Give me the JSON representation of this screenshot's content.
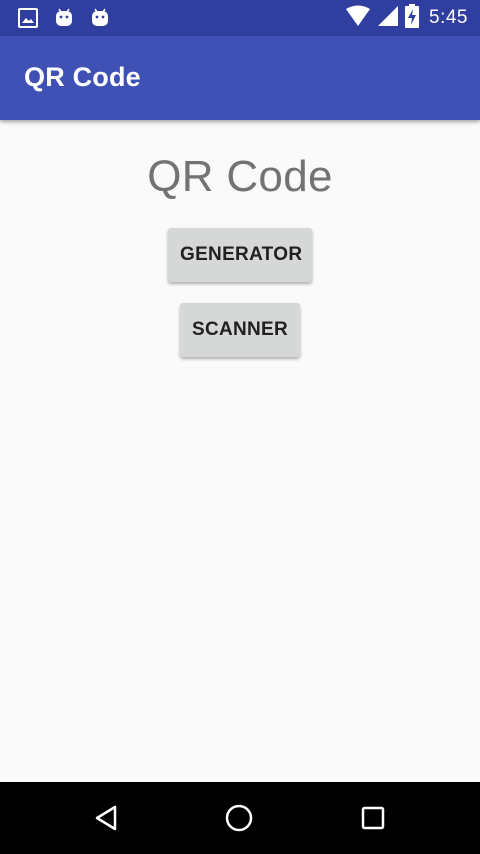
{
  "status_bar": {
    "time": "5:45",
    "left_icons": [
      "image-icon",
      "android-icon",
      "android-icon"
    ],
    "right_icons": [
      "wifi-icon",
      "signal-icon",
      "battery-charging-icon"
    ]
  },
  "app_bar": {
    "title": "QR Code"
  },
  "main": {
    "heading": "QR Code",
    "buttons": {
      "generator": "GENERATOR",
      "scanner": "SCANNER"
    }
  },
  "nav_bar": {
    "icons": [
      "back-icon",
      "home-icon",
      "recents-icon"
    ]
  },
  "colors": {
    "status_bar": "#303f9f",
    "app_bar": "#3f51b5",
    "background": "#fafafa",
    "button": "#d6d7d7",
    "heading_text": "#737373"
  }
}
